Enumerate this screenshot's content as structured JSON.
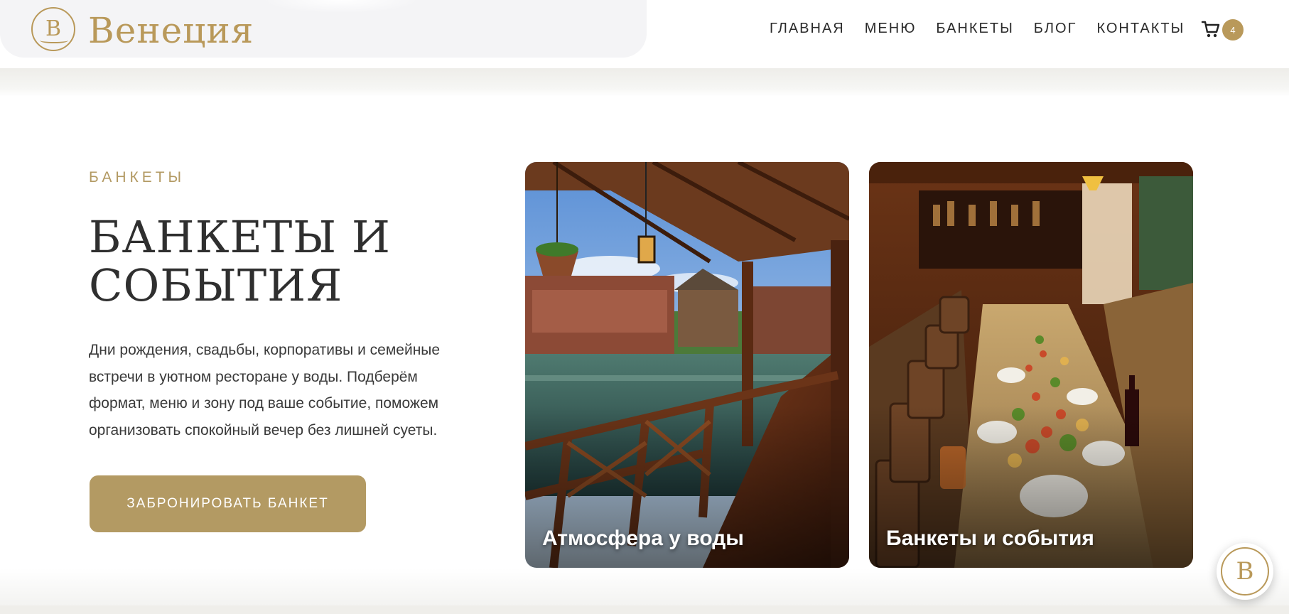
{
  "brand": {
    "logo_letter": "B",
    "name": "Венеция",
    "accent_color": "#b9995a"
  },
  "nav": {
    "items": [
      {
        "label": "ГЛАВНАЯ"
      },
      {
        "label": "МЕНЮ"
      },
      {
        "label": "БАНКЕТЫ"
      },
      {
        "label": "БЛОГ"
      },
      {
        "label": "КОНТАКТЫ"
      }
    ],
    "cart_icon": "cart-icon",
    "cart_count": "4"
  },
  "hero": {
    "eyebrow": "БАНКЕТЫ",
    "title": "БАНКЕТЫ И СОБЫТИЯ",
    "lead": "Дни рождения, свадьбы, корпоративы и семейные встречи в уютном ресторане у воды. Подберём формат, меню и зону под ваше событие, поможем организовать спокойный вечер без лишней суеты.",
    "cta_label": "ЗАБРОНИРОВАТЬ БАНКЕТ",
    "cta_color": "#b39a63"
  },
  "cards": [
    {
      "caption": "Атмосфера у воды"
    },
    {
      "caption": "Банкеты и события"
    }
  ],
  "chat_widget": {
    "logo_letter": "B"
  }
}
